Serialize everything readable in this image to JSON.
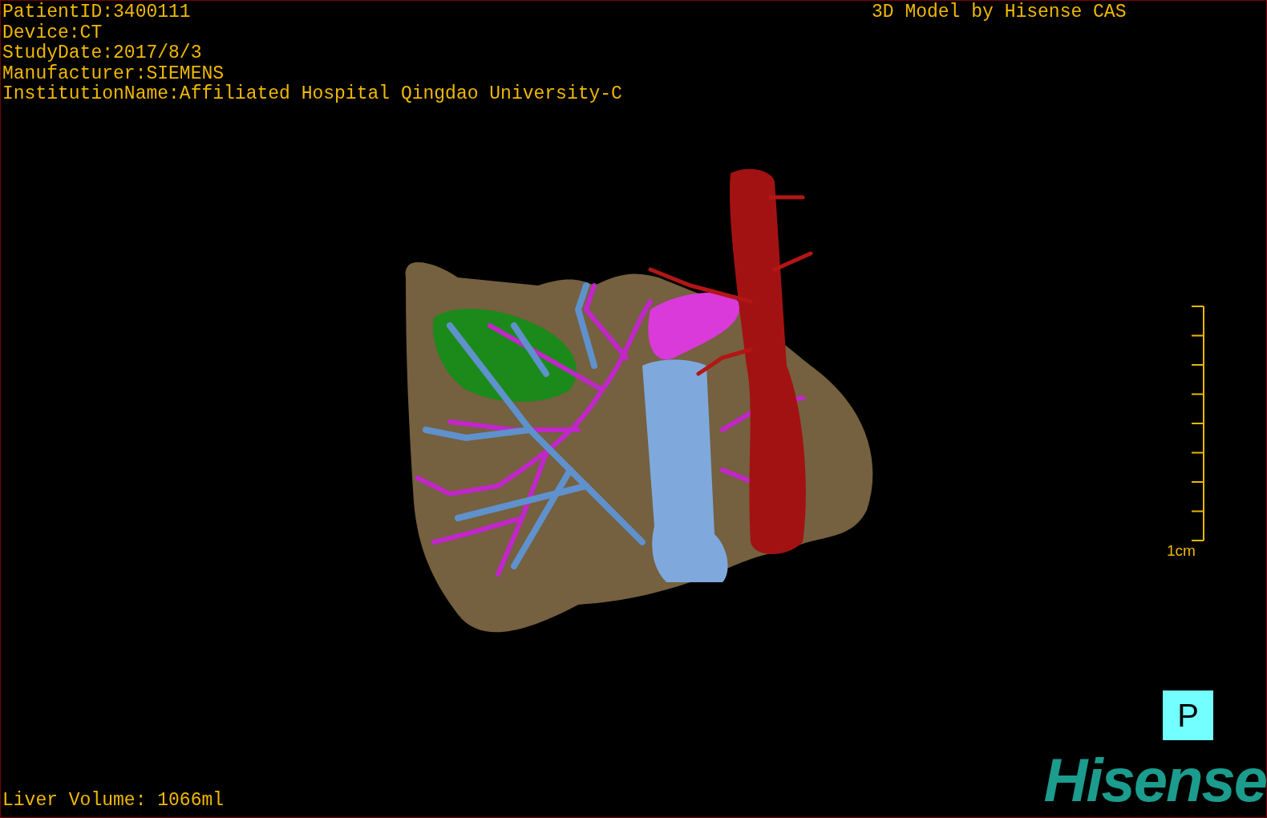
{
  "info_lines": [
    "PatientID:3400111",
    "Device:CT",
    "StudyDate:2017/8/3",
    "Manufacturer:SIEMENS",
    "InstitutionName:Affiliated Hospital Qingdao University-C"
  ],
  "caption": "3D Model by Hisense CAS",
  "scale_bar": {
    "label": "1cm"
  },
  "orientation_marker": "P",
  "logo": "Hisense",
  "liver_volume": "Liver Volume: 1066ml"
}
